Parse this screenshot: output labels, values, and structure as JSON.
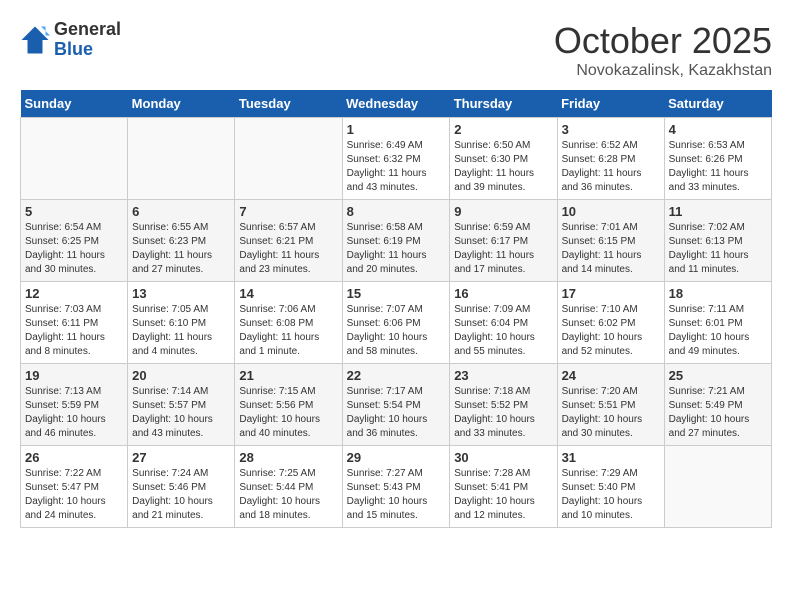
{
  "logo": {
    "general": "General",
    "blue": "Blue"
  },
  "title": "October 2025",
  "location": "Novokazalinsk, Kazakhstan",
  "weekdays": [
    "Sunday",
    "Monday",
    "Tuesday",
    "Wednesday",
    "Thursday",
    "Friday",
    "Saturday"
  ],
  "weeks": [
    [
      {
        "day": "",
        "info": ""
      },
      {
        "day": "",
        "info": ""
      },
      {
        "day": "",
        "info": ""
      },
      {
        "day": "1",
        "info": "Sunrise: 6:49 AM\nSunset: 6:32 PM\nDaylight: 11 hours\nand 43 minutes."
      },
      {
        "day": "2",
        "info": "Sunrise: 6:50 AM\nSunset: 6:30 PM\nDaylight: 11 hours\nand 39 minutes."
      },
      {
        "day": "3",
        "info": "Sunrise: 6:52 AM\nSunset: 6:28 PM\nDaylight: 11 hours\nand 36 minutes."
      },
      {
        "day": "4",
        "info": "Sunrise: 6:53 AM\nSunset: 6:26 PM\nDaylight: 11 hours\nand 33 minutes."
      }
    ],
    [
      {
        "day": "5",
        "info": "Sunrise: 6:54 AM\nSunset: 6:25 PM\nDaylight: 11 hours\nand 30 minutes."
      },
      {
        "day": "6",
        "info": "Sunrise: 6:55 AM\nSunset: 6:23 PM\nDaylight: 11 hours\nand 27 minutes."
      },
      {
        "day": "7",
        "info": "Sunrise: 6:57 AM\nSunset: 6:21 PM\nDaylight: 11 hours\nand 23 minutes."
      },
      {
        "day": "8",
        "info": "Sunrise: 6:58 AM\nSunset: 6:19 PM\nDaylight: 11 hours\nand 20 minutes."
      },
      {
        "day": "9",
        "info": "Sunrise: 6:59 AM\nSunset: 6:17 PM\nDaylight: 11 hours\nand 17 minutes."
      },
      {
        "day": "10",
        "info": "Sunrise: 7:01 AM\nSunset: 6:15 PM\nDaylight: 11 hours\nand 14 minutes."
      },
      {
        "day": "11",
        "info": "Sunrise: 7:02 AM\nSunset: 6:13 PM\nDaylight: 11 hours\nand 11 minutes."
      }
    ],
    [
      {
        "day": "12",
        "info": "Sunrise: 7:03 AM\nSunset: 6:11 PM\nDaylight: 11 hours\nand 8 minutes."
      },
      {
        "day": "13",
        "info": "Sunrise: 7:05 AM\nSunset: 6:10 PM\nDaylight: 11 hours\nand 4 minutes."
      },
      {
        "day": "14",
        "info": "Sunrise: 7:06 AM\nSunset: 6:08 PM\nDaylight: 11 hours\nand 1 minute."
      },
      {
        "day": "15",
        "info": "Sunrise: 7:07 AM\nSunset: 6:06 PM\nDaylight: 10 hours\nand 58 minutes."
      },
      {
        "day": "16",
        "info": "Sunrise: 7:09 AM\nSunset: 6:04 PM\nDaylight: 10 hours\nand 55 minutes."
      },
      {
        "day": "17",
        "info": "Sunrise: 7:10 AM\nSunset: 6:02 PM\nDaylight: 10 hours\nand 52 minutes."
      },
      {
        "day": "18",
        "info": "Sunrise: 7:11 AM\nSunset: 6:01 PM\nDaylight: 10 hours\nand 49 minutes."
      }
    ],
    [
      {
        "day": "19",
        "info": "Sunrise: 7:13 AM\nSunset: 5:59 PM\nDaylight: 10 hours\nand 46 minutes."
      },
      {
        "day": "20",
        "info": "Sunrise: 7:14 AM\nSunset: 5:57 PM\nDaylight: 10 hours\nand 43 minutes."
      },
      {
        "day": "21",
        "info": "Sunrise: 7:15 AM\nSunset: 5:56 PM\nDaylight: 10 hours\nand 40 minutes."
      },
      {
        "day": "22",
        "info": "Sunrise: 7:17 AM\nSunset: 5:54 PM\nDaylight: 10 hours\nand 36 minutes."
      },
      {
        "day": "23",
        "info": "Sunrise: 7:18 AM\nSunset: 5:52 PM\nDaylight: 10 hours\nand 33 minutes."
      },
      {
        "day": "24",
        "info": "Sunrise: 7:20 AM\nSunset: 5:51 PM\nDaylight: 10 hours\nand 30 minutes."
      },
      {
        "day": "25",
        "info": "Sunrise: 7:21 AM\nSunset: 5:49 PM\nDaylight: 10 hours\nand 27 minutes."
      }
    ],
    [
      {
        "day": "26",
        "info": "Sunrise: 7:22 AM\nSunset: 5:47 PM\nDaylight: 10 hours\nand 24 minutes."
      },
      {
        "day": "27",
        "info": "Sunrise: 7:24 AM\nSunset: 5:46 PM\nDaylight: 10 hours\nand 21 minutes."
      },
      {
        "day": "28",
        "info": "Sunrise: 7:25 AM\nSunset: 5:44 PM\nDaylight: 10 hours\nand 18 minutes."
      },
      {
        "day": "29",
        "info": "Sunrise: 7:27 AM\nSunset: 5:43 PM\nDaylight: 10 hours\nand 15 minutes."
      },
      {
        "day": "30",
        "info": "Sunrise: 7:28 AM\nSunset: 5:41 PM\nDaylight: 10 hours\nand 12 minutes."
      },
      {
        "day": "31",
        "info": "Sunrise: 7:29 AM\nSunset: 5:40 PM\nDaylight: 10 hours\nand 10 minutes."
      },
      {
        "day": "",
        "info": ""
      }
    ]
  ]
}
